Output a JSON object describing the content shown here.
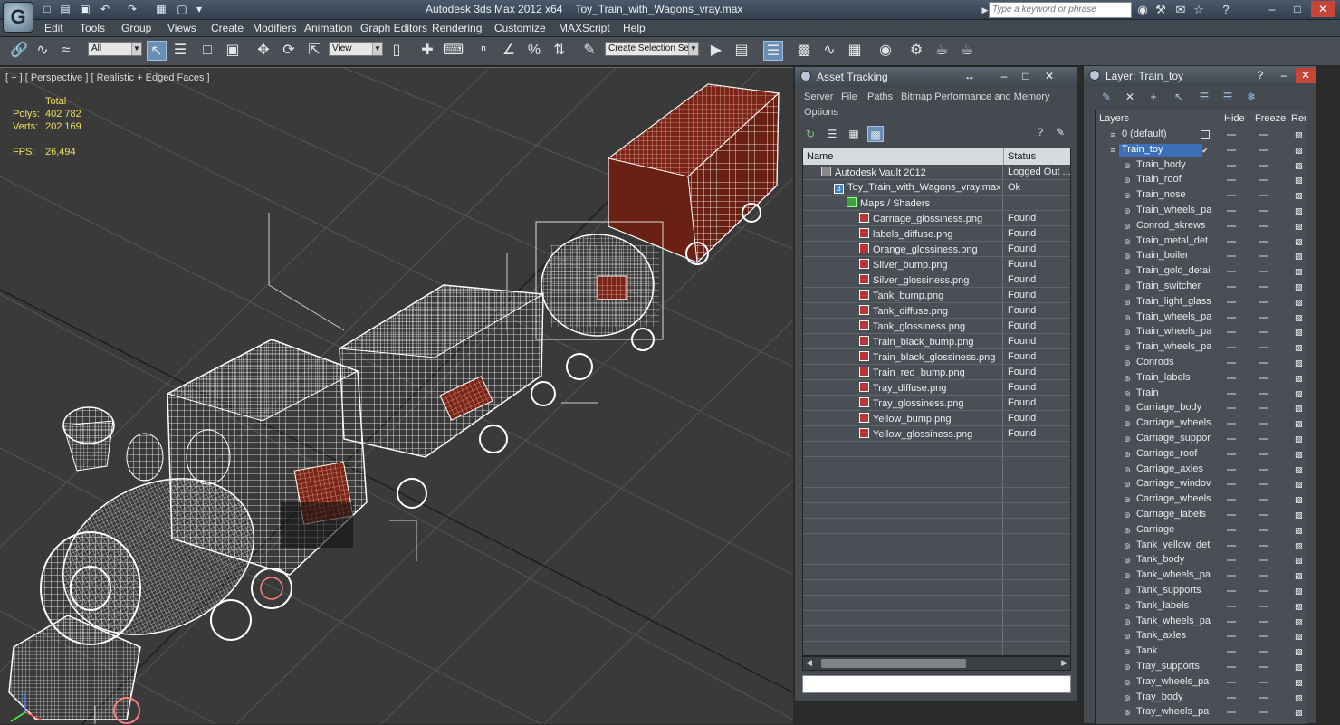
{
  "app": {
    "logo_glyph": "G",
    "title": "Autodesk 3ds Max  2012 x64",
    "file": "Toy_Train_with_Wagons_vray.max",
    "search_placeholder": "Type a keyword or phrase"
  },
  "menu": [
    "Edit",
    "Tools",
    "Group",
    "Views",
    "Create",
    "Modifiers",
    "Animation",
    "Graph Editors",
    "Rendering",
    "Customize",
    "MAXScript",
    "Help"
  ],
  "toolbar": {
    "filter_combo": "All",
    "refcoord_combo": "View",
    "selection_set_combo": "Create Selection Se"
  },
  "viewport": {
    "label": "[ + ] [ Perspective ] [ Realistic + Edged Faces ]",
    "stats": {
      "total_label": "Total",
      "polys_label": "Polys:",
      "polys_value": "402 782",
      "verts_label": "Verts:",
      "verts_value": "202 169",
      "fps_label": "FPS:",
      "fps_value": "26,494"
    }
  },
  "asset_tracking": {
    "title": "Asset Tracking",
    "menu": [
      "Server",
      "File",
      "Paths",
      "Bitmap Performance and Memory",
      "Options"
    ],
    "columns": {
      "name": "Name",
      "status": "Status"
    },
    "rows": [
      {
        "name": "Autodesk Vault 2012",
        "status": "Logged Out ...",
        "level": 0,
        "icon": "vault-icon"
      },
      {
        "name": "Toy_Train_with_Wagons_vray.max",
        "status": "Ok",
        "level": 1,
        "icon": "max-file-icon"
      },
      {
        "name": "Maps / Shaders",
        "status": "",
        "level": 2,
        "icon": "maps-icon"
      },
      {
        "name": "Carriage_glossiness.png",
        "status": "Found",
        "level": 3,
        "icon": "bitmap-icon"
      },
      {
        "name": "labels_diffuse.png",
        "status": "Found",
        "level": 3,
        "icon": "bitmap-icon"
      },
      {
        "name": "Orange_glossiness.png",
        "status": "Found",
        "level": 3,
        "icon": "bitmap-icon"
      },
      {
        "name": "Silver_bump.png",
        "status": "Found",
        "level": 3,
        "icon": "bitmap-icon"
      },
      {
        "name": "Silver_glossiness.png",
        "status": "Found",
        "level": 3,
        "icon": "bitmap-icon"
      },
      {
        "name": "Tank_bump.png",
        "status": "Found",
        "level": 3,
        "icon": "bitmap-icon"
      },
      {
        "name": "Tank_diffuse.png",
        "status": "Found",
        "level": 3,
        "icon": "bitmap-icon"
      },
      {
        "name": "Tank_glossiness.png",
        "status": "Found",
        "level": 3,
        "icon": "bitmap-icon"
      },
      {
        "name": "Train_black_bump.png",
        "status": "Found",
        "level": 3,
        "icon": "bitmap-icon"
      },
      {
        "name": "Train_black_glossiness.png",
        "status": "Found",
        "level": 3,
        "icon": "bitmap-icon"
      },
      {
        "name": "Train_red_bump.png",
        "status": "Found",
        "level": 3,
        "icon": "bitmap-icon"
      },
      {
        "name": "Tray_diffuse.png",
        "status": "Found",
        "level": 3,
        "icon": "bitmap-icon"
      },
      {
        "name": "Tray_glossiness.png",
        "status": "Found",
        "level": 3,
        "icon": "bitmap-icon"
      },
      {
        "name": "Yellow_bump.png",
        "status": "Found",
        "level": 3,
        "icon": "bitmap-icon"
      },
      {
        "name": "Yellow_glossiness.png",
        "status": "Found",
        "level": 3,
        "icon": "bitmap-icon"
      }
    ]
  },
  "layers": {
    "title": "Layer: Train_toy",
    "columns": {
      "layers": "Layers",
      "hide": "Hide",
      "freeze": "Freeze",
      "render": "Rende"
    },
    "items": [
      {
        "name": "0 (default)",
        "level": 0
      },
      {
        "name": "Train_toy",
        "level": 0,
        "selected": true
      },
      {
        "name": "Train_body",
        "level": 1
      },
      {
        "name": "Train_roof",
        "level": 1
      },
      {
        "name": "Train_nose",
        "level": 1
      },
      {
        "name": "Train_wheels_pa",
        "level": 1
      },
      {
        "name": "Conrod_skrews",
        "level": 1
      },
      {
        "name": "Train_metal_det",
        "level": 1
      },
      {
        "name": "Train_boiler",
        "level": 1
      },
      {
        "name": "Train_gold_detai",
        "level": 1
      },
      {
        "name": "Train_switcher",
        "level": 1
      },
      {
        "name": "Train_light_glass",
        "level": 1
      },
      {
        "name": "Train_wheels_pa",
        "level": 1
      },
      {
        "name": "Train_wheels_pa",
        "level": 1
      },
      {
        "name": "Train_wheels_pa",
        "level": 1
      },
      {
        "name": "Conrods",
        "level": 1
      },
      {
        "name": "Train_labels",
        "level": 1
      },
      {
        "name": "Train",
        "level": 1
      },
      {
        "name": "Carriage_body",
        "level": 1
      },
      {
        "name": "Carriage_wheels",
        "level": 1
      },
      {
        "name": "Carriage_suppor",
        "level": 1
      },
      {
        "name": "Carriage_roof",
        "level": 1
      },
      {
        "name": "Carriage_axles",
        "level": 1
      },
      {
        "name": "Carriage_windov",
        "level": 1
      },
      {
        "name": "Carriage_wheels",
        "level": 1
      },
      {
        "name": "Carriage_labels",
        "level": 1
      },
      {
        "name": "Carriage",
        "level": 1
      },
      {
        "name": "Tank_yellow_det",
        "level": 1
      },
      {
        "name": "Tank_body",
        "level": 1
      },
      {
        "name": "Tank_wheels_pa",
        "level": 1
      },
      {
        "name": "Tank_supports",
        "level": 1
      },
      {
        "name": "Tank_labels",
        "level": 1
      },
      {
        "name": "Tank_wheels_pa",
        "level": 1
      },
      {
        "name": "Tank_axles",
        "level": 1
      },
      {
        "name": "Tank",
        "level": 1
      },
      {
        "name": "Tray_supports",
        "level": 1
      },
      {
        "name": "Tray_wheels_pa",
        "level": 1
      },
      {
        "name": "Tray_body",
        "level": 1
      },
      {
        "name": "Tray_wheels_pa",
        "level": 1
      }
    ]
  },
  "colors": {
    "selection_blue": "#3d6fb8",
    "stats_yellow": "#f2e05a",
    "wire_white": "#ffffff",
    "texture_red": "#8a2a1a"
  }
}
